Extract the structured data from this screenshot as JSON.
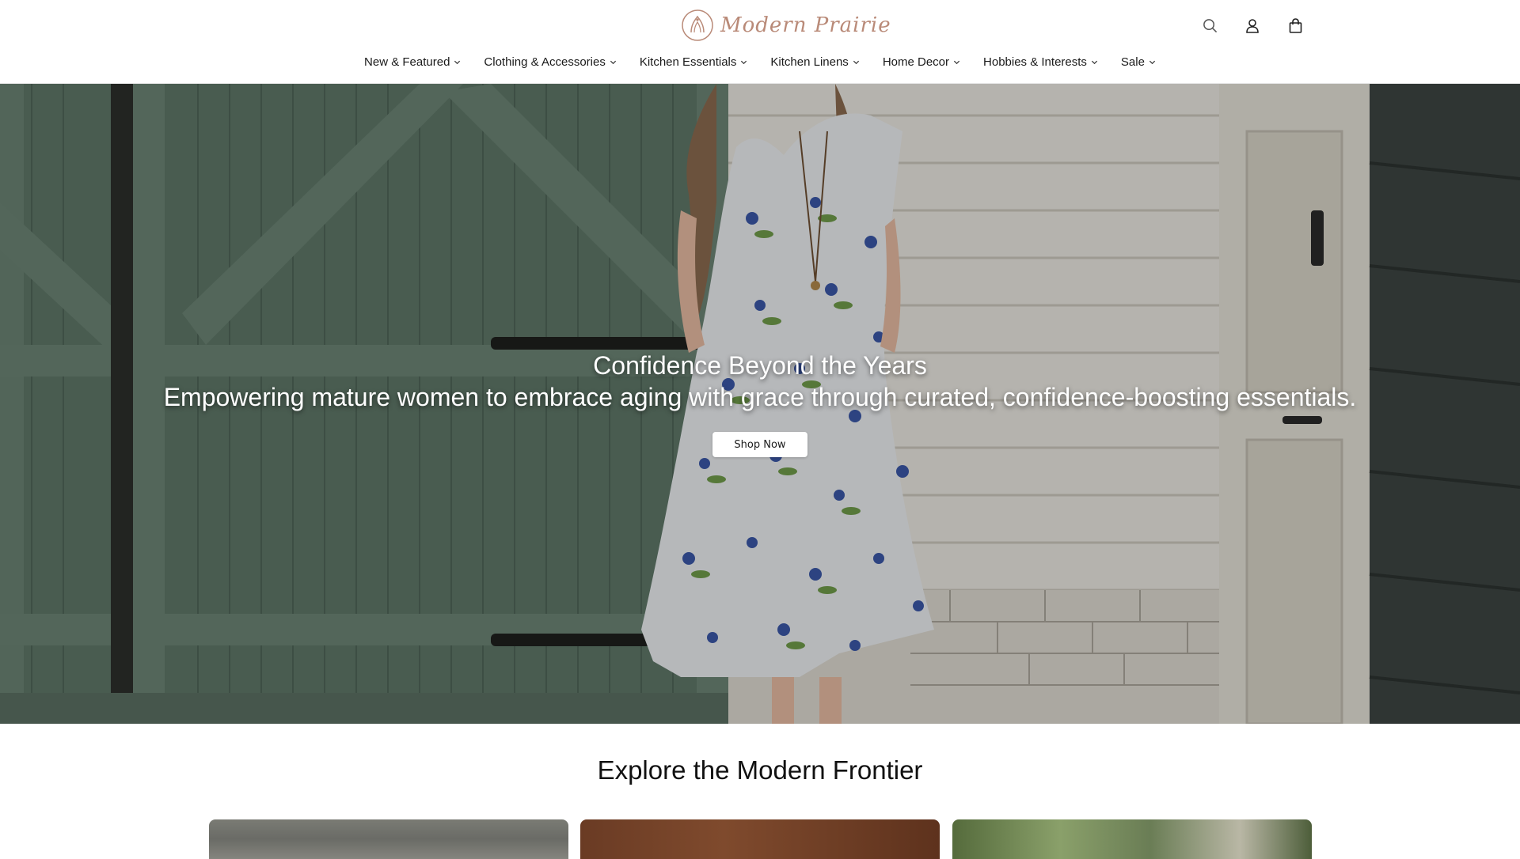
{
  "brand": {
    "name": "Modern Prairie"
  },
  "header_icons": [
    "search-icon",
    "account-icon",
    "cart-icon"
  ],
  "nav": {
    "items": [
      {
        "label": "New & Featured"
      },
      {
        "label": "Clothing & Accessories"
      },
      {
        "label": "Kitchen Essentials"
      },
      {
        "label": "Kitchen Linens"
      },
      {
        "label": "Home Decor"
      },
      {
        "label": "Hobbies & Interests"
      },
      {
        "label": "Sale"
      }
    ]
  },
  "hero": {
    "title": "Confidence Beyond the Years",
    "subtitle": "Empowering mature women to embrace aging with grace through curated, confidence-boosting essentials.",
    "cta_label": "Shop Now"
  },
  "collections": {
    "title": "Explore the Modern Frontier"
  },
  "colors": {
    "logo": "#b98a78",
    "barn_door": "#5e7667",
    "siding": "#e8e6df"
  }
}
